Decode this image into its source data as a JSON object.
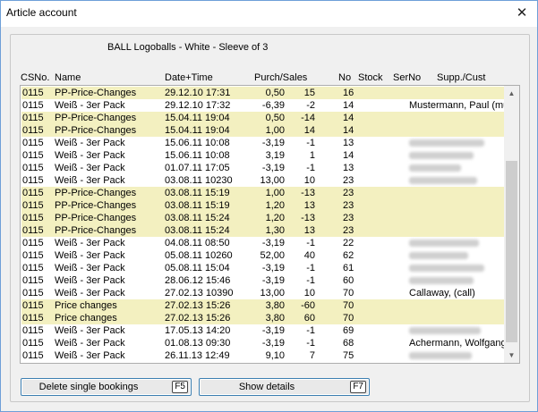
{
  "window": {
    "title": "Article account",
    "close_glyph": "✕"
  },
  "article": {
    "label": "BALL  Logoballs - White - Sleeve of 3"
  },
  "columns": {
    "csno": "CSNo.",
    "name": "Name",
    "datetime": "Date+Time",
    "purch_sales": "Purch/Sales",
    "no": "No",
    "stock": "Stock",
    "serno": "SerNo",
    "supp_cust": "Supp./Cust"
  },
  "colors": {
    "highlight": "#f3f0c0"
  },
  "rows": [
    {
      "csno": "0115",
      "name": "PP-Price-Changes",
      "datetime": "29.12.10 17:31",
      "purch": "0,50",
      "sales": "15",
      "no": "16",
      "cust": "",
      "hl": true,
      "blurred": false
    },
    {
      "csno": "0115",
      "name": "Weiß - 3er Pack",
      "datetime": "29.12.10 17:32",
      "purch": "-6,39",
      "sales": "-2",
      "no": "14",
      "cust": "Mustermann, Paul (mu",
      "hl": false,
      "blurred": false
    },
    {
      "csno": "0115",
      "name": "PP-Price-Changes",
      "datetime": "15.04.11 19:04",
      "purch": "0,50",
      "sales": "-14",
      "no": "14",
      "cust": "",
      "hl": true,
      "blurred": false
    },
    {
      "csno": "0115",
      "name": "PP-Price-Changes",
      "datetime": "15.04.11 19:04",
      "purch": "1,00",
      "sales": "14",
      "no": "14",
      "cust": "",
      "hl": true,
      "blurred": false
    },
    {
      "csno": "0115",
      "name": "Weiß - 3er Pack",
      "datetime": "15.06.11 10:08",
      "purch": "-3,19",
      "sales": "-1",
      "no": "13",
      "cust": "",
      "hl": false,
      "blurred": true
    },
    {
      "csno": "0115",
      "name": "Weiß - 3er Pack",
      "datetime": "15.06.11 10:08",
      "purch": "3,19",
      "sales": "1",
      "no": "14",
      "cust": "",
      "hl": false,
      "blurred": true
    },
    {
      "csno": "0115",
      "name": "Weiß - 3er Pack",
      "datetime": "01.07.11 17:05",
      "purch": "-3,19",
      "sales": "-1",
      "no": "13",
      "cust": "",
      "hl": false,
      "blurred": true
    },
    {
      "csno": "0115",
      "name": "Weiß - 3er Pack",
      "datetime": "03.08.11 10230",
      "purch": "13,00",
      "sales": "10",
      "no": "23",
      "cust": "",
      "hl": false,
      "blurred": true
    },
    {
      "csno": "0115",
      "name": "PP-Price-Changes",
      "datetime": "03.08.11 15:19",
      "purch": "1,00",
      "sales": "-13",
      "no": "23",
      "cust": "",
      "hl": true,
      "blurred": false
    },
    {
      "csno": "0115",
      "name": "PP-Price-Changes",
      "datetime": "03.08.11 15:19",
      "purch": "1,20",
      "sales": "13",
      "no": "23",
      "cust": "",
      "hl": true,
      "blurred": false
    },
    {
      "csno": "0115",
      "name": "PP-Price-Changes",
      "datetime": "03.08.11 15:24",
      "purch": "1,20",
      "sales": "-13",
      "no": "23",
      "cust": "",
      "hl": true,
      "blurred": false
    },
    {
      "csno": "0115",
      "name": "PP-Price-Changes",
      "datetime": "03.08.11 15:24",
      "purch": "1,30",
      "sales": "13",
      "no": "23",
      "cust": "",
      "hl": true,
      "blurred": false
    },
    {
      "csno": "0115",
      "name": "Weiß - 3er Pack",
      "datetime": "04.08.11 08:50",
      "purch": "-3,19",
      "sales": "-1",
      "no": "22",
      "cust": "",
      "hl": false,
      "blurred": true
    },
    {
      "csno": "0115",
      "name": "Weiß - 3er Pack",
      "datetime": "05.08.11 10260",
      "purch": "52,00",
      "sales": "40",
      "no": "62",
      "cust": "",
      "hl": false,
      "blurred": true
    },
    {
      "csno": "0115",
      "name": "Weiß - 3er Pack",
      "datetime": "05.08.11 15:04",
      "purch": "-3,19",
      "sales": "-1",
      "no": "61",
      "cust": "",
      "hl": false,
      "blurred": true
    },
    {
      "csno": "0115",
      "name": "Weiß - 3er Pack",
      "datetime": "28.06.12 15:46",
      "purch": "-3,19",
      "sales": "-1",
      "no": "60",
      "cust": "",
      "hl": false,
      "blurred": true
    },
    {
      "csno": "0115",
      "name": "Weiß - 3er Pack",
      "datetime": "27.02.13 10390",
      "purch": "13,00",
      "sales": "10",
      "no": "70",
      "cust": "Callaway,  (call)",
      "hl": false,
      "blurred": false
    },
    {
      "csno": "0115",
      "name": "Price changes",
      "datetime": "27.02.13 15:26",
      "purch": "3,80",
      "sales": "-60",
      "no": "70",
      "cust": "",
      "hl": true,
      "blurred": false
    },
    {
      "csno": "0115",
      "name": "Price changes",
      "datetime": "27.02.13 15:26",
      "purch": "3,80",
      "sales": "60",
      "no": "70",
      "cust": "",
      "hl": true,
      "blurred": false
    },
    {
      "csno": "0115",
      "name": "Weiß - 3er Pack",
      "datetime": "17.05.13 14:20",
      "purch": "-3,19",
      "sales": "-1",
      "no": "69",
      "cust": "",
      "hl": false,
      "blurred": true
    },
    {
      "csno": "0115",
      "name": "Weiß - 3er Pack",
      "datetime": "01.08.13 09:30",
      "purch": "-3,19",
      "sales": "-1",
      "no": "68",
      "cust": "Achermann, Wolfgang",
      "hl": false,
      "blurred": false
    },
    {
      "csno": "0115",
      "name": "Weiß - 3er Pack",
      "datetime": "26.11.13 12:49",
      "purch": "9,10",
      "sales": "7",
      "no": "75",
      "cust": "",
      "hl": false,
      "blurred": true
    }
  ],
  "buttons": {
    "delete": {
      "label": "Delete single bookings",
      "key": "F5"
    },
    "show": {
      "label": "Show details",
      "key": "F7"
    }
  }
}
